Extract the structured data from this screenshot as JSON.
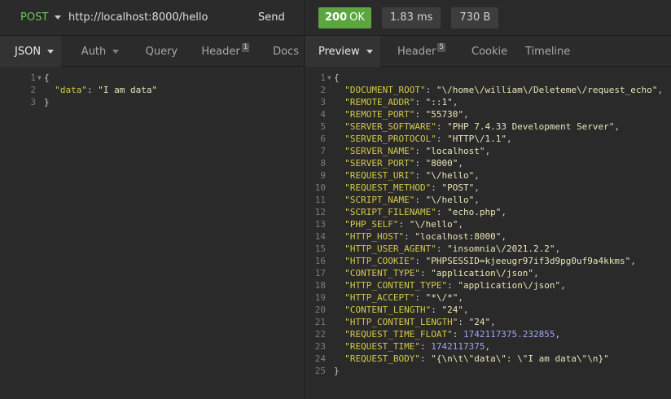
{
  "request": {
    "method": "POST",
    "url": "http://localhost:8000/hello",
    "send_label": "Send",
    "tabs": [
      {
        "label": "JSON"
      },
      {
        "label": "Auth"
      },
      {
        "label": "Query"
      },
      {
        "label": "Header",
        "count": "1"
      },
      {
        "label": "Docs"
      }
    ],
    "body_lines": [
      {
        "n": "1",
        "parts": [
          {
            "t": "punc",
            "v": "{"
          }
        ]
      },
      {
        "n": "2",
        "parts": [
          {
            "t": "punc",
            "v": "  "
          },
          {
            "t": "key",
            "v": "\"data\""
          },
          {
            "t": "punc",
            "v": ": "
          },
          {
            "t": "str",
            "v": "\"I am data\""
          }
        ]
      },
      {
        "n": "3",
        "parts": [
          {
            "t": "punc",
            "v": "}"
          }
        ]
      }
    ]
  },
  "response": {
    "status_code": "200",
    "status_text": "OK",
    "time": "1.83 ms",
    "size": "730 B",
    "tabs": [
      {
        "label": "Preview"
      },
      {
        "label": "Header",
        "count": "5"
      },
      {
        "label": "Cookie"
      },
      {
        "label": "Timeline"
      }
    ],
    "body_lines": [
      {
        "n": "1",
        "parts": [
          {
            "t": "punc",
            "v": "{"
          }
        ]
      },
      {
        "n": "2",
        "parts": [
          {
            "t": "punc",
            "v": "  "
          },
          {
            "t": "key",
            "v": "\"DOCUMENT_ROOT\""
          },
          {
            "t": "punc",
            "v": ": "
          },
          {
            "t": "str",
            "v": "\"\\/home\\/william\\/Deleteme\\/request_echo\""
          },
          {
            "t": "punc",
            "v": ","
          }
        ]
      },
      {
        "n": "3",
        "parts": [
          {
            "t": "punc",
            "v": "  "
          },
          {
            "t": "key",
            "v": "\"REMOTE_ADDR\""
          },
          {
            "t": "punc",
            "v": ": "
          },
          {
            "t": "str",
            "v": "\"::1\""
          },
          {
            "t": "punc",
            "v": ","
          }
        ]
      },
      {
        "n": "4",
        "parts": [
          {
            "t": "punc",
            "v": "  "
          },
          {
            "t": "key",
            "v": "\"REMOTE_PORT\""
          },
          {
            "t": "punc",
            "v": ": "
          },
          {
            "t": "str",
            "v": "\"55730\""
          },
          {
            "t": "punc",
            "v": ","
          }
        ]
      },
      {
        "n": "5",
        "parts": [
          {
            "t": "punc",
            "v": "  "
          },
          {
            "t": "key",
            "v": "\"SERVER_SOFTWARE\""
          },
          {
            "t": "punc",
            "v": ": "
          },
          {
            "t": "str",
            "v": "\"PHP 7.4.33 Development Server\""
          },
          {
            "t": "punc",
            "v": ","
          }
        ]
      },
      {
        "n": "6",
        "parts": [
          {
            "t": "punc",
            "v": "  "
          },
          {
            "t": "key",
            "v": "\"SERVER_PROTOCOL\""
          },
          {
            "t": "punc",
            "v": ": "
          },
          {
            "t": "str",
            "v": "\"HTTP\\/1.1\""
          },
          {
            "t": "punc",
            "v": ","
          }
        ]
      },
      {
        "n": "7",
        "parts": [
          {
            "t": "punc",
            "v": "  "
          },
          {
            "t": "key",
            "v": "\"SERVER_NAME\""
          },
          {
            "t": "punc",
            "v": ": "
          },
          {
            "t": "str",
            "v": "\"localhost\""
          },
          {
            "t": "punc",
            "v": ","
          }
        ]
      },
      {
        "n": "8",
        "parts": [
          {
            "t": "punc",
            "v": "  "
          },
          {
            "t": "key",
            "v": "\"SERVER_PORT\""
          },
          {
            "t": "punc",
            "v": ": "
          },
          {
            "t": "str",
            "v": "\"8000\""
          },
          {
            "t": "punc",
            "v": ","
          }
        ]
      },
      {
        "n": "9",
        "parts": [
          {
            "t": "punc",
            "v": "  "
          },
          {
            "t": "key",
            "v": "\"REQUEST_URI\""
          },
          {
            "t": "punc",
            "v": ": "
          },
          {
            "t": "str",
            "v": "\"\\/hello\""
          },
          {
            "t": "punc",
            "v": ","
          }
        ]
      },
      {
        "n": "10",
        "parts": [
          {
            "t": "punc",
            "v": "  "
          },
          {
            "t": "key",
            "v": "\"REQUEST_METHOD\""
          },
          {
            "t": "punc",
            "v": ": "
          },
          {
            "t": "str",
            "v": "\"POST\""
          },
          {
            "t": "punc",
            "v": ","
          }
        ]
      },
      {
        "n": "11",
        "parts": [
          {
            "t": "punc",
            "v": "  "
          },
          {
            "t": "key",
            "v": "\"SCRIPT_NAME\""
          },
          {
            "t": "punc",
            "v": ": "
          },
          {
            "t": "str",
            "v": "\"\\/hello\""
          },
          {
            "t": "punc",
            "v": ","
          }
        ]
      },
      {
        "n": "12",
        "parts": [
          {
            "t": "punc",
            "v": "  "
          },
          {
            "t": "key",
            "v": "\"SCRIPT_FILENAME\""
          },
          {
            "t": "punc",
            "v": ": "
          },
          {
            "t": "str",
            "v": "\"echo.php\""
          },
          {
            "t": "punc",
            "v": ","
          }
        ]
      },
      {
        "n": "13",
        "parts": [
          {
            "t": "punc",
            "v": "  "
          },
          {
            "t": "key",
            "v": "\"PHP_SELF\""
          },
          {
            "t": "punc",
            "v": ": "
          },
          {
            "t": "str",
            "v": "\"\\/hello\""
          },
          {
            "t": "punc",
            "v": ","
          }
        ]
      },
      {
        "n": "14",
        "parts": [
          {
            "t": "punc",
            "v": "  "
          },
          {
            "t": "key",
            "v": "\"HTTP_HOST\""
          },
          {
            "t": "punc",
            "v": ": "
          },
          {
            "t": "str",
            "v": "\"localhost:8000\""
          },
          {
            "t": "punc",
            "v": ","
          }
        ]
      },
      {
        "n": "15",
        "parts": [
          {
            "t": "punc",
            "v": "  "
          },
          {
            "t": "key",
            "v": "\"HTTP_USER_AGENT\""
          },
          {
            "t": "punc",
            "v": ": "
          },
          {
            "t": "str",
            "v": "\"insomnia\\/2021.2.2\""
          },
          {
            "t": "punc",
            "v": ","
          }
        ]
      },
      {
        "n": "16",
        "parts": [
          {
            "t": "punc",
            "v": "  "
          },
          {
            "t": "key",
            "v": "\"HTTP_COOKIE\""
          },
          {
            "t": "punc",
            "v": ": "
          },
          {
            "t": "str",
            "v": "\"PHPSESSID=kjeeugr97if3d9pg0uf9a4kkms\""
          },
          {
            "t": "punc",
            "v": ","
          }
        ]
      },
      {
        "n": "17",
        "parts": [
          {
            "t": "punc",
            "v": "  "
          },
          {
            "t": "key",
            "v": "\"CONTENT_TYPE\""
          },
          {
            "t": "punc",
            "v": ": "
          },
          {
            "t": "str",
            "v": "\"application\\/json\""
          },
          {
            "t": "punc",
            "v": ","
          }
        ]
      },
      {
        "n": "18",
        "parts": [
          {
            "t": "punc",
            "v": "  "
          },
          {
            "t": "key",
            "v": "\"HTTP_CONTENT_TYPE\""
          },
          {
            "t": "punc",
            "v": ": "
          },
          {
            "t": "str",
            "v": "\"application\\/json\""
          },
          {
            "t": "punc",
            "v": ","
          }
        ]
      },
      {
        "n": "19",
        "parts": [
          {
            "t": "punc",
            "v": "  "
          },
          {
            "t": "key",
            "v": "\"HTTP_ACCEPT\""
          },
          {
            "t": "punc",
            "v": ": "
          },
          {
            "t": "str",
            "v": "\"*\\/*\""
          },
          {
            "t": "punc",
            "v": ","
          }
        ]
      },
      {
        "n": "20",
        "parts": [
          {
            "t": "punc",
            "v": "  "
          },
          {
            "t": "key",
            "v": "\"CONTENT_LENGTH\""
          },
          {
            "t": "punc",
            "v": ": "
          },
          {
            "t": "str",
            "v": "\"24\""
          },
          {
            "t": "punc",
            "v": ","
          }
        ]
      },
      {
        "n": "21",
        "parts": [
          {
            "t": "punc",
            "v": "  "
          },
          {
            "t": "key",
            "v": "\"HTTP_CONTENT_LENGTH\""
          },
          {
            "t": "punc",
            "v": ": "
          },
          {
            "t": "str",
            "v": "\"24\""
          },
          {
            "t": "punc",
            "v": ","
          }
        ]
      },
      {
        "n": "22",
        "parts": [
          {
            "t": "punc",
            "v": "  "
          },
          {
            "t": "key",
            "v": "\"REQUEST_TIME_FLOAT\""
          },
          {
            "t": "punc",
            "v": ": "
          },
          {
            "t": "num",
            "v": "1742117375.232855"
          },
          {
            "t": "punc",
            "v": ","
          }
        ]
      },
      {
        "n": "23",
        "parts": [
          {
            "t": "punc",
            "v": "  "
          },
          {
            "t": "key",
            "v": "\"REQUEST_TIME\""
          },
          {
            "t": "punc",
            "v": ": "
          },
          {
            "t": "num",
            "v": "1742117375"
          },
          {
            "t": "punc",
            "v": ","
          }
        ]
      },
      {
        "n": "24",
        "parts": [
          {
            "t": "punc",
            "v": "  "
          },
          {
            "t": "key",
            "v": "\"REQUEST_BODY\""
          },
          {
            "t": "punc",
            "v": ": "
          },
          {
            "t": "str",
            "v": "\"{\\n\\t\\\"data\\\": \\\"I am data\\\"\\n}\""
          }
        ]
      },
      {
        "n": "25",
        "parts": [
          {
            "t": "punc",
            "v": "}"
          }
        ]
      }
    ]
  },
  "colors": {
    "method": "#6bc45a",
    "status_ok": "#5ba63e",
    "key": "#d3c84a",
    "string": "#e8e4b8",
    "number": "#9fa7f0"
  },
  "icons": {
    "dropdown": "chevron-down-icon",
    "fold": "fold-arrow-icon"
  }
}
